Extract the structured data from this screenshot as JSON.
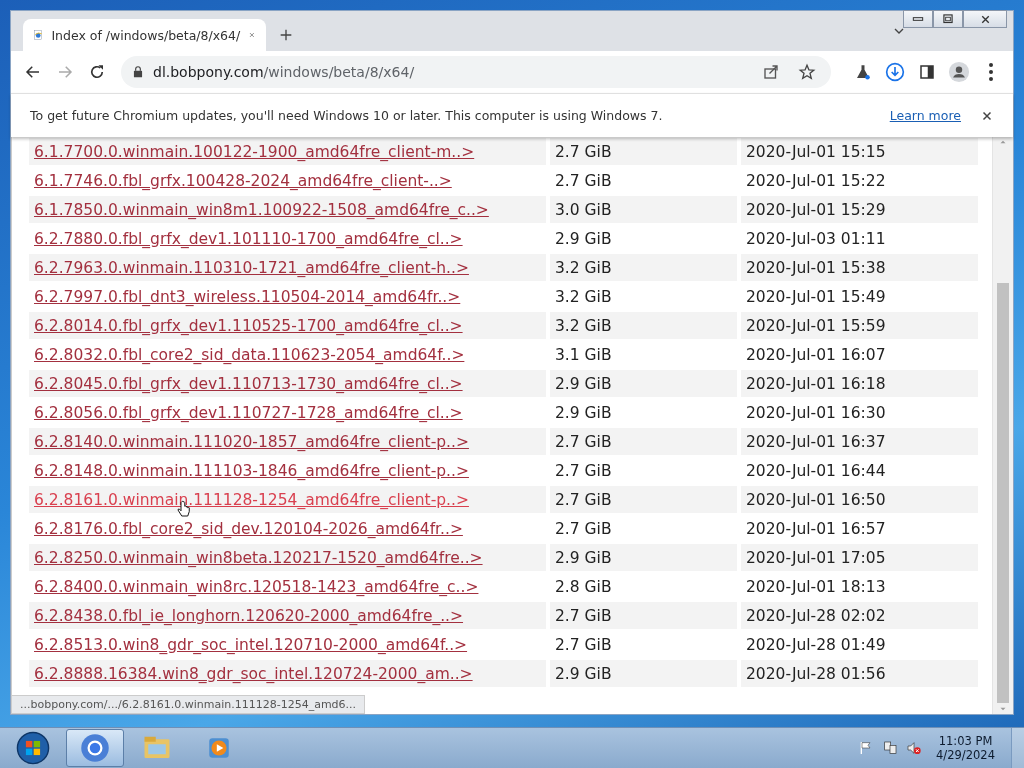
{
  "browser": {
    "tabs": [
      {
        "title": "Index of /windows/beta/8/x64/",
        "selected": true
      }
    ],
    "address": {
      "domain": "dl.bobpony.com",
      "path": "/windows/beta/8/x64/"
    },
    "infobar": {
      "message": "To get future Chromium updates, you'll need Windows 10 or later. This computer is using Windows 7.",
      "link": "Learn more"
    }
  },
  "listing": {
    "rows": [
      {
        "name": "6.1.7700.0.winmain.100122-1900_amd64fre_client-m..>",
        "size": "2.7 GiB",
        "date": "2020-Jul-01 15:15",
        "hovered": false
      },
      {
        "name": "6.1.7746.0.fbl_grfx.100428-2024_amd64fre_client-..>",
        "size": "2.7 GiB",
        "date": "2020-Jul-01 15:22",
        "hovered": false
      },
      {
        "name": "6.1.7850.0.winmain_win8m1.100922-1508_amd64fre_c..>",
        "size": "3.0 GiB",
        "date": "2020-Jul-01 15:29",
        "hovered": false
      },
      {
        "name": "6.2.7880.0.fbl_grfx_dev1.101110-1700_amd64fre_cl..>",
        "size": "2.9 GiB",
        "date": "2020-Jul-03 01:11",
        "hovered": false
      },
      {
        "name": "6.2.7963.0.winmain.110310-1721_amd64fre_client-h..>",
        "size": "3.2 GiB",
        "date": "2020-Jul-01 15:38",
        "hovered": false
      },
      {
        "name": "6.2.7997.0.fbl_dnt3_wireless.110504-2014_amd64fr..>",
        "size": "3.2 GiB",
        "date": "2020-Jul-01 15:49",
        "hovered": false
      },
      {
        "name": "6.2.8014.0.fbl_grfx_dev1.110525-1700_amd64fre_cl..>",
        "size": "3.2 GiB",
        "date": "2020-Jul-01 15:59",
        "hovered": false
      },
      {
        "name": "6.2.8032.0.fbl_core2_sid_data.110623-2054_amd64f..>",
        "size": "3.1 GiB",
        "date": "2020-Jul-01 16:07",
        "hovered": false
      },
      {
        "name": "6.2.8045.0.fbl_grfx_dev1.110713-1730_amd64fre_cl..>",
        "size": "2.9 GiB",
        "date": "2020-Jul-01 16:18",
        "hovered": false
      },
      {
        "name": "6.2.8056.0.fbl_grfx_dev1.110727-1728_amd64fre_cl..>",
        "size": "2.9 GiB",
        "date": "2020-Jul-01 16:30",
        "hovered": false
      },
      {
        "name": "6.2.8140.0.winmain.111020-1857_amd64fre_client-p..>",
        "size": "2.7 GiB",
        "date": "2020-Jul-01 16:37",
        "hovered": false
      },
      {
        "name": "6.2.8148.0.winmain.111103-1846_amd64fre_client-p..>",
        "size": "2.7 GiB",
        "date": "2020-Jul-01 16:44",
        "hovered": false
      },
      {
        "name": "6.2.8161.0.winmain.111128-1254_amd64fre_client-p..>",
        "size": "2.7 GiB",
        "date": "2020-Jul-01 16:50",
        "hovered": true
      },
      {
        "name": "6.2.8176.0.fbl_core2_sid_dev.120104-2026_amd64fr..>",
        "size": "2.7 GiB",
        "date": "2020-Jul-01 16:57",
        "hovered": false
      },
      {
        "name": "6.2.8250.0.winmain_win8beta.120217-1520_amd64fre..>",
        "size": "2.9 GiB",
        "date": "2020-Jul-01 17:05",
        "hovered": false
      },
      {
        "name": "6.2.8400.0.winmain_win8rc.120518-1423_amd64fre_c..>",
        "size": "2.8 GiB",
        "date": "2020-Jul-01 18:13",
        "hovered": false
      },
      {
        "name": "6.2.8438.0.fbl_ie_longhorn.120620-2000_amd64fre_..>",
        "size": "2.7 GiB",
        "date": "2020-Jul-28 02:02",
        "hovered": false
      },
      {
        "name": "6.2.8513.0.win8_gdr_soc_intel.120710-2000_amd64f..>",
        "size": "2.7 GiB",
        "date": "2020-Jul-28 01:49",
        "hovered": false
      },
      {
        "name": "6.2.8888.16384.win8_gdr_soc_intel.120724-2000_am..>",
        "size": "2.9 GiB",
        "date": "2020-Jul-28 01:56",
        "hovered": false
      }
    ]
  },
  "status_bubble": "...bobpony.com/.../6.2.8161.0.winmain.111128-1254_amd6...",
  "taskbar": {
    "apps": [
      {
        "kind": "chrome",
        "selected": true
      },
      {
        "kind": "explorer",
        "selected": false
      },
      {
        "kind": "media",
        "selected": false
      }
    ],
    "clock": {
      "time": "11:03 PM",
      "date": "4/29/2024"
    }
  }
}
